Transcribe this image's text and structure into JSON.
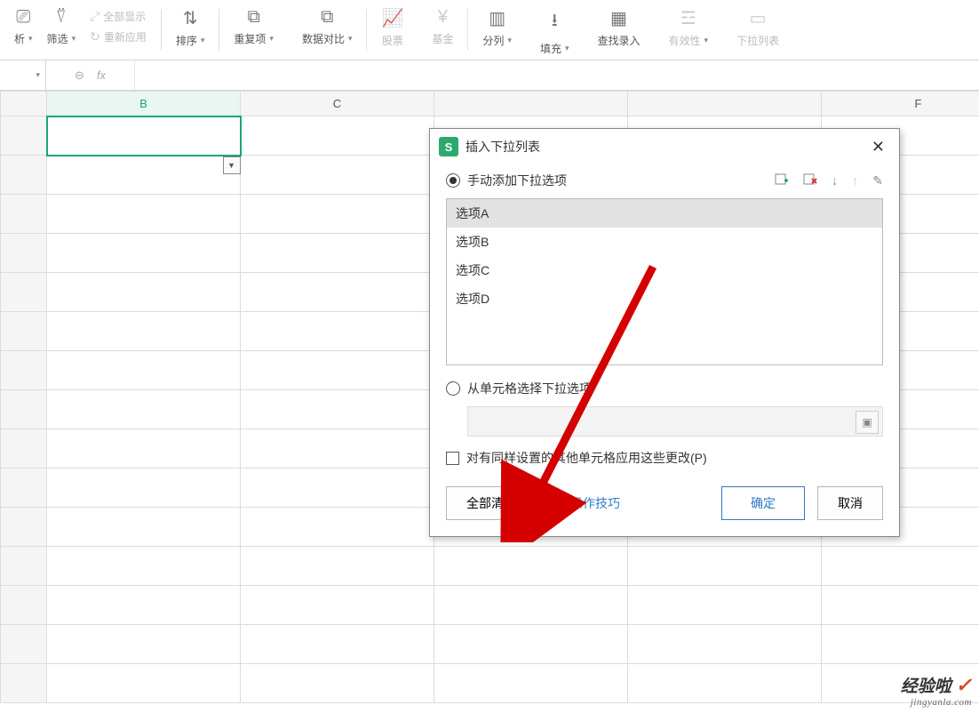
{
  "ribbon": {
    "filter_group_partial": "析",
    "filter": "筛选",
    "show_all": "全部显示",
    "reapply": "重新应用",
    "sort": "排序",
    "duplicates": "重复项",
    "data_compare": "数据对比",
    "stock": "股票",
    "fund": "基金",
    "text_to_columns": "分列",
    "fill": "填充",
    "find_entry": "查找录入",
    "validity": "有效性",
    "dropdown_list": "下拉列表"
  },
  "columns": {
    "B": "B",
    "C": "C",
    "F": "F"
  },
  "dialog": {
    "title": "插入下拉列表",
    "radio_manual": "手动添加下拉选项",
    "options": [
      "选项A",
      "选项B",
      "选项C",
      "选项D"
    ],
    "radio_from_cells": "从单元格选择下拉选项",
    "checkbox_apply": "对有同样设置的其他单元格应用这些更改(P)",
    "btn_clear": "全部清除",
    "tips": "操作技巧",
    "btn_ok": "确定",
    "btn_cancel": "取消"
  },
  "watermark": {
    "text": "经验啦",
    "url": "jingyanla.com"
  }
}
